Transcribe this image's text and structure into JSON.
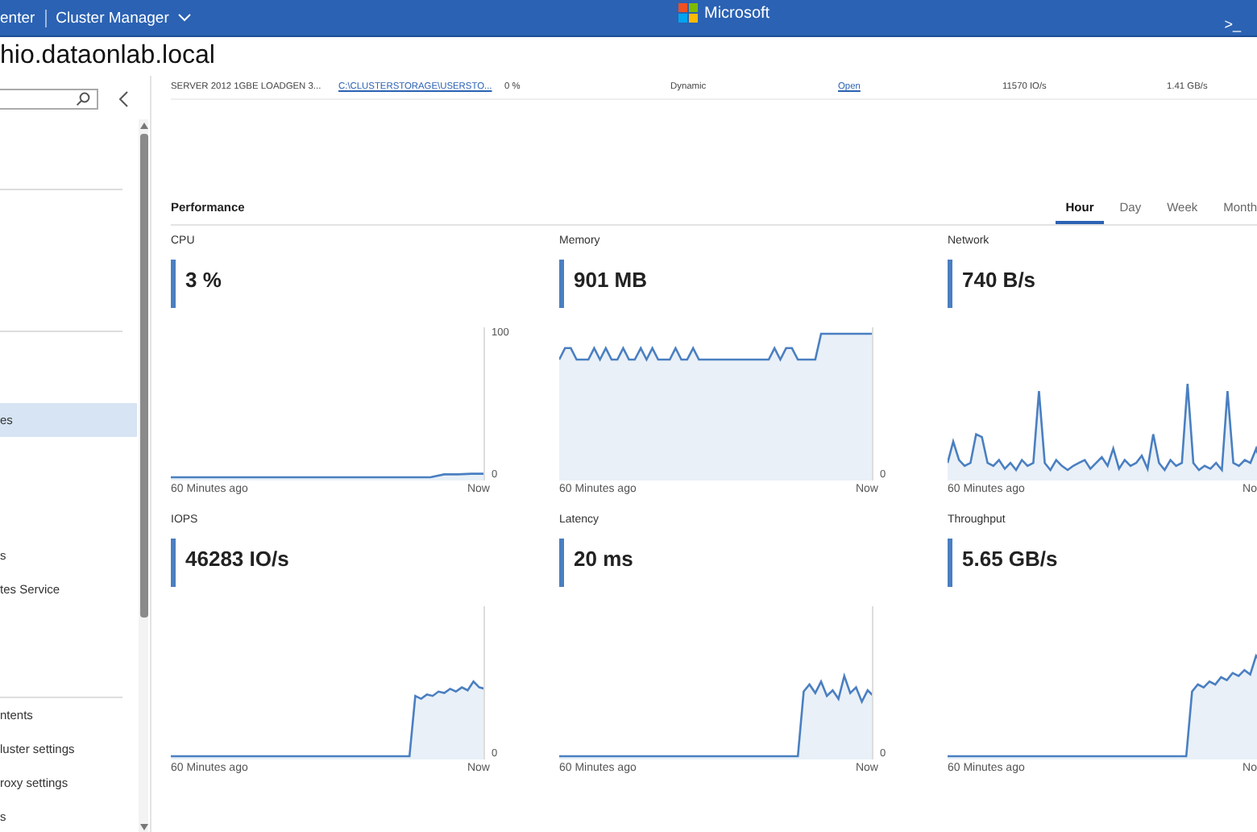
{
  "top_bar": {
    "breadcrumb": "enter",
    "app_menu": "Cluster Manager",
    "brand": "Microsoft",
    "terminal": ">_"
  },
  "title": "hio.dataonlab.local",
  "sidebar": {
    "groups": [
      {
        "items": [
          {
            "label": "es",
            "selected": true
          },
          {
            "label": "s",
            "selected": false
          },
          {
            "label": "tes Service",
            "selected": false
          }
        ]
      },
      {
        "items": [
          {
            "label": "ntents",
            "selected": false
          },
          {
            "label": "luster settings",
            "selected": false
          },
          {
            "label": "roxy settings",
            "selected": false
          },
          {
            "label": "s",
            "selected": false
          }
        ]
      }
    ]
  },
  "table": {
    "rows": [
      {
        "cells": [
          {
            "kind": "text",
            "text": "SERVER 2012 1GBE LOADGEN 3..."
          },
          {
            "kind": "link",
            "text": "C:\\CLUSTERSTORAGE\\USERSTO..."
          },
          {
            "kind": "text",
            "text": "0 %"
          },
          {
            "kind": "text",
            "text": "Dynamic"
          },
          {
            "kind": "link",
            "text": "Open"
          },
          {
            "kind": "text",
            "text": "11570 IO/s"
          },
          {
            "kind": "text",
            "text": "1.41 GB/s"
          }
        ]
      }
    ]
  },
  "performance": {
    "title": "Performance",
    "ranges": [
      {
        "label": "Hour",
        "selected": true
      },
      {
        "label": "Day",
        "selected": false
      },
      {
        "label": "Week",
        "selected": false
      },
      {
        "label": "Month",
        "selected": false
      }
    ],
    "panels": [
      {
        "label": "CPU",
        "value": "3 %",
        "y_ticks": [
          "100",
          "0"
        ],
        "start_label": "60 Minutes ago",
        "end_label": "Now"
      },
      {
        "label": "Memory",
        "value": "901 MB",
        "y_ticks": [
          "0"
        ],
        "start_label": "60 Minutes ago",
        "end_label": "Now"
      },
      {
        "label": "Network",
        "value": "740 B/s",
        "start_label": "60 Minutes ago",
        "end_label": "No"
      },
      {
        "label": "IOPS",
        "value": "46283 IO/s",
        "y_ticks": [
          "0"
        ],
        "start_label": "60 Minutes ago",
        "end_label": "Now"
      },
      {
        "label": "Latency",
        "value": "20 ms",
        "y_ticks": [
          "0"
        ],
        "start_label": "60 Minutes ago",
        "end_label": "Now"
      },
      {
        "label": "Throughput",
        "value": "5.65 GB/s",
        "start_label": "60 Minutes ago",
        "end_label": "No"
      }
    ]
  }
}
